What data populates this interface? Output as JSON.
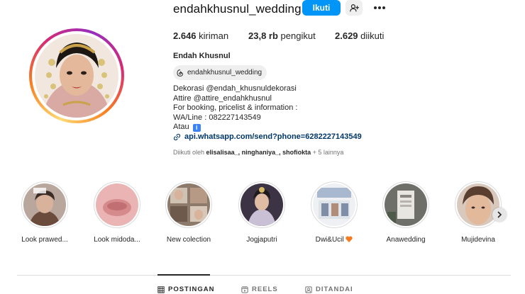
{
  "profile": {
    "username": "endahkhusnul_wedding",
    "follow_label": "Ikuti",
    "adduser_icon": "person-add-icon",
    "more_icon": "more-horizontal-icon",
    "stats": {
      "posts_count": "2.646",
      "posts_label": "kiriman",
      "followers_count": "23,8 rb",
      "followers_label": "pengikut",
      "following_count": "2.629",
      "following_label": "diikuti"
    },
    "full_name": "Endah Khusnul",
    "threads_handle": "endahkhusnul_wedding",
    "bio_lines": [
      "Dekorasi @endah_khusnuldekorasi",
      "Attire @attire_endahkhusnul",
      "For booking, pricelist & information :",
      "WA/Line : 082227143549",
      "Atau"
    ],
    "info_emoji": "i",
    "link": "api.whatsapp.com/send?phone=6282227143549",
    "followed_by_prefix": "Diikuti oleh",
    "followed_by_names": "elisalisaa_, ninghaniya_, shofiokta",
    "followed_by_suffix": "+ 5 lainnya"
  },
  "highlights": [
    {
      "label": "Look prawed..."
    },
    {
      "label": "Look midoda..."
    },
    {
      "label": "New colection"
    },
    {
      "label": "Jogjaputri"
    },
    {
      "label": "Dwi&Ucil",
      "emoji": "orange-heart"
    },
    {
      "label": "Anawedding"
    },
    {
      "label": "Mujidevina"
    }
  ],
  "tabs": [
    {
      "label": "POSTINGAN",
      "icon": "grid-icon",
      "active": true
    },
    {
      "label": "REELS",
      "icon": "reels-icon",
      "active": false
    },
    {
      "label": "DITANDAI",
      "icon": "tagged-icon",
      "active": false
    }
  ],
  "colors": {
    "accent": "#0095f6",
    "link": "#00376b",
    "muted": "#737373"
  }
}
